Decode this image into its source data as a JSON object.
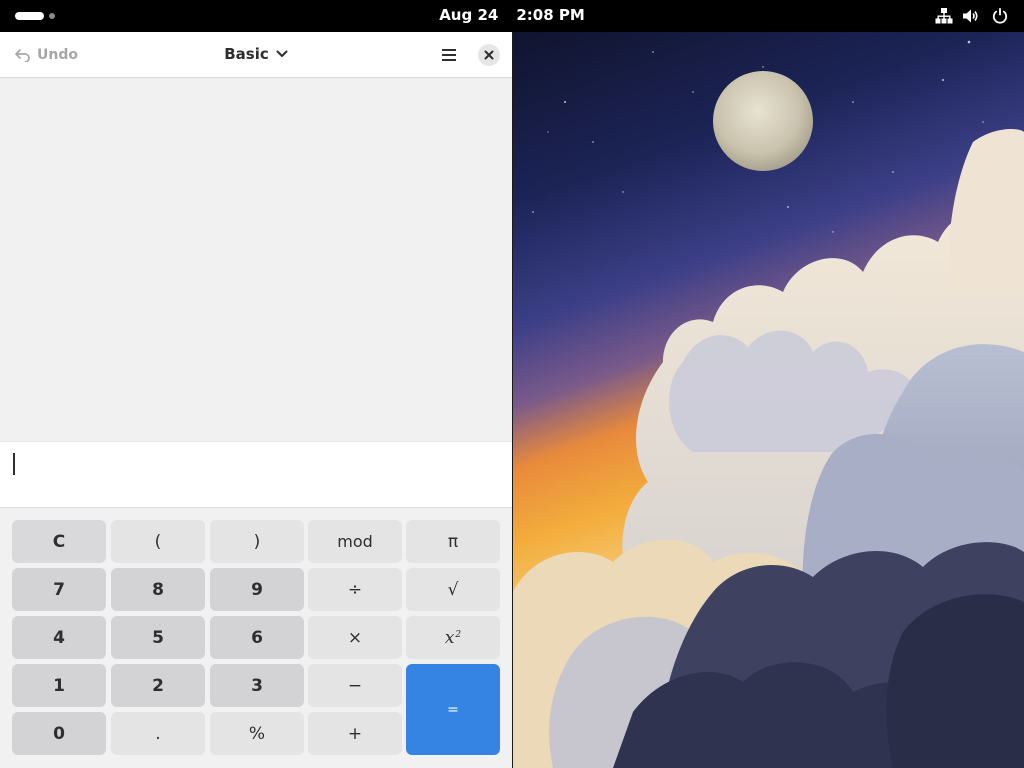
{
  "topbar": {
    "date": "Aug 24",
    "time": "2:08 PM",
    "icons": [
      "network-icon",
      "volume-icon",
      "power-icon"
    ]
  },
  "calculator": {
    "undo_label": "Undo",
    "mode_label": "Basic",
    "entry_value": "",
    "keys": {
      "clear": "C",
      "lparen": "(",
      "rparen": ")",
      "mod": "mod",
      "pi": "π",
      "seven": "7",
      "eight": "8",
      "nine": "9",
      "divide": "÷",
      "sqrt": "√",
      "four": "4",
      "five": "5",
      "six": "6",
      "multiply": "×",
      "square_base": "x",
      "square_exp": "2",
      "one": "1",
      "two": "2",
      "three": "3",
      "subtract": "−",
      "equals": "=",
      "zero": "0",
      "point": ".",
      "percent": "%",
      "add": "+"
    },
    "accent_color": "#3584e4"
  }
}
